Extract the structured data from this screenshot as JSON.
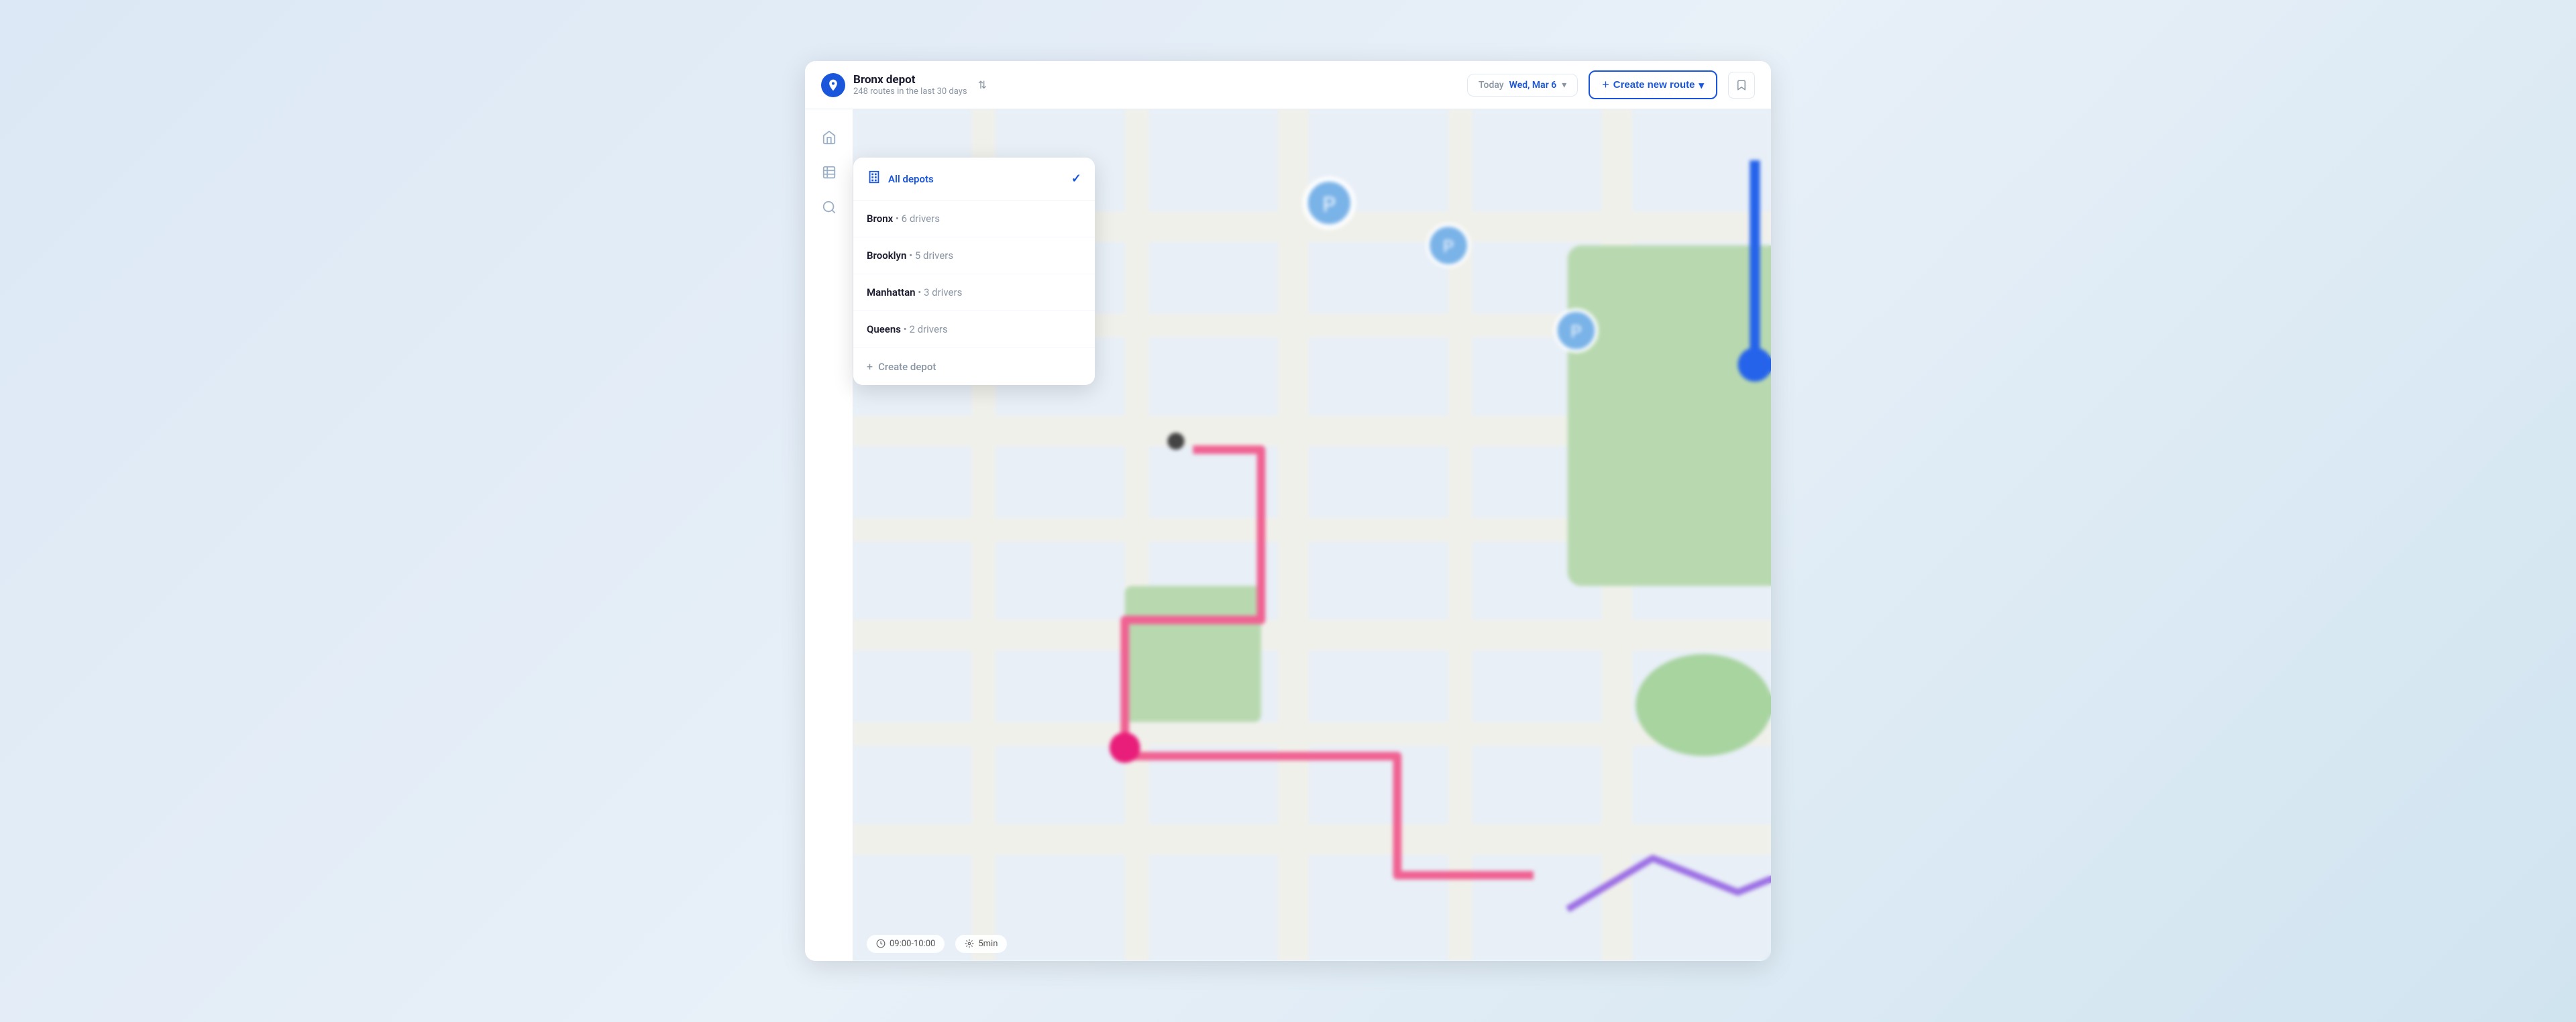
{
  "header": {
    "depot_name": "Bronx depot",
    "depot_subtitle": "248 routes in the last 30 days",
    "date_label": "Today",
    "date_value": "Wed, Mar 6",
    "create_route_label": "Create new route",
    "bookmark_icon": "🔖"
  },
  "sidebar": {
    "items": [
      {
        "icon": "home",
        "label": "home-icon",
        "unicode": "⌂"
      },
      {
        "icon": "chart",
        "label": "analytics-icon",
        "unicode": "▦"
      },
      {
        "icon": "search",
        "label": "search-icon",
        "unicode": "🔍"
      }
    ]
  },
  "dropdown": {
    "all_depots_label": "All depots",
    "checkmark": "✓",
    "depots": [
      {
        "name": "Bronx",
        "drivers": "6 drivers"
      },
      {
        "name": "Brooklyn",
        "drivers": "5 drivers"
      },
      {
        "name": "Manhattan",
        "drivers": "3 drivers"
      },
      {
        "name": "Queens",
        "drivers": "2 drivers"
      }
    ],
    "create_depot_label": "Create depot",
    "dot_separator": "•"
  },
  "map": {
    "time_label": "09:00-10:00",
    "distance_label": "5min"
  },
  "colors": {
    "blue_primary": "#1a56db",
    "route_blue": "#2563eb",
    "route_pink": "#f06292",
    "route_purple": "#9c6fe4",
    "green_area": "#a8d5a2",
    "map_bg": "#e8eff7",
    "road_bg": "#f5f5f0"
  }
}
